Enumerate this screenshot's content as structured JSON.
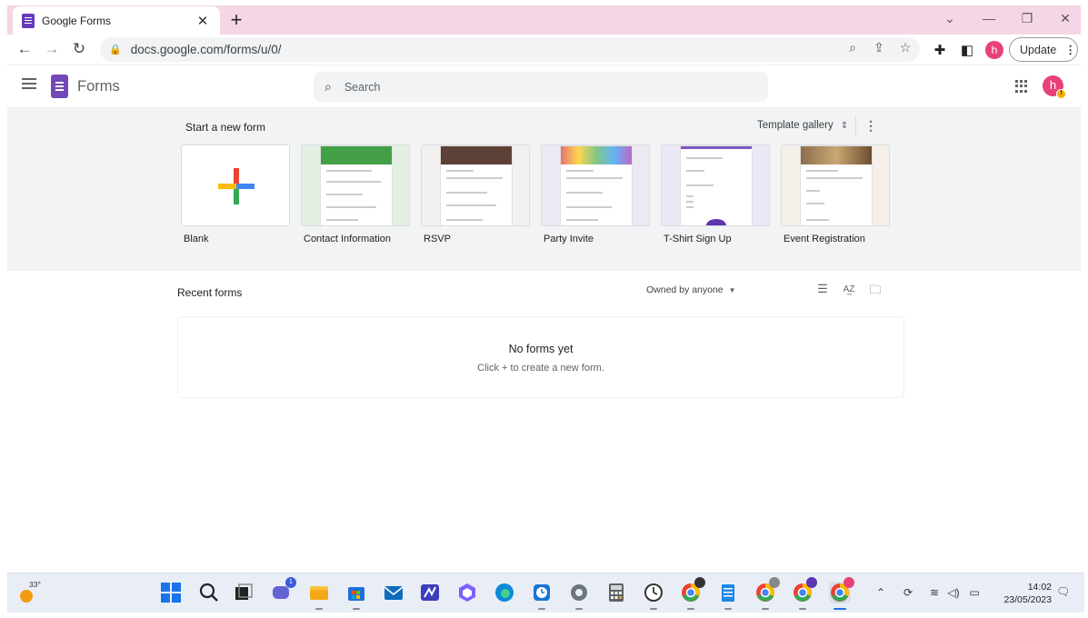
{
  "browser": {
    "tab_title": "Google Forms",
    "tab_close": "✕",
    "new_tab": "+",
    "url": "docs.google.com/forms/u/0/",
    "profile_initial": "h",
    "update_label": "Update"
  },
  "app": {
    "name": "Forms",
    "search_placeholder": "Search",
    "avatar_initial": "h"
  },
  "templates": {
    "heading": "Start a new form",
    "gallery_label": "Template gallery",
    "cards": [
      {
        "label": "Blank",
        "icon": "plus-icon"
      },
      {
        "label": "Contact Information",
        "accent": "#43a047"
      },
      {
        "label": "RSVP",
        "accent": "#5d4037"
      },
      {
        "label": "Party Invite",
        "accent": "#9c7bd0"
      },
      {
        "label": "T-Shirt Sign Up",
        "accent": "#7e57c2"
      },
      {
        "label": "Event Registration",
        "accent": "#8d6e4c"
      }
    ]
  },
  "recent": {
    "heading": "Recent forms",
    "owner_filter": "Owned by anyone",
    "empty_title": "No forms yet",
    "empty_subtitle": "Click + to create a new form."
  },
  "taskbar": {
    "temperature": "33°",
    "chat_badge": "1",
    "time": "14:02",
    "date": "23/05/2023"
  },
  "colors": {
    "forms_purple": "#673ab7",
    "tab_strip": "#f5d6e6",
    "template_band": "#f1f3f4",
    "profile_pink": "#e8417a"
  }
}
